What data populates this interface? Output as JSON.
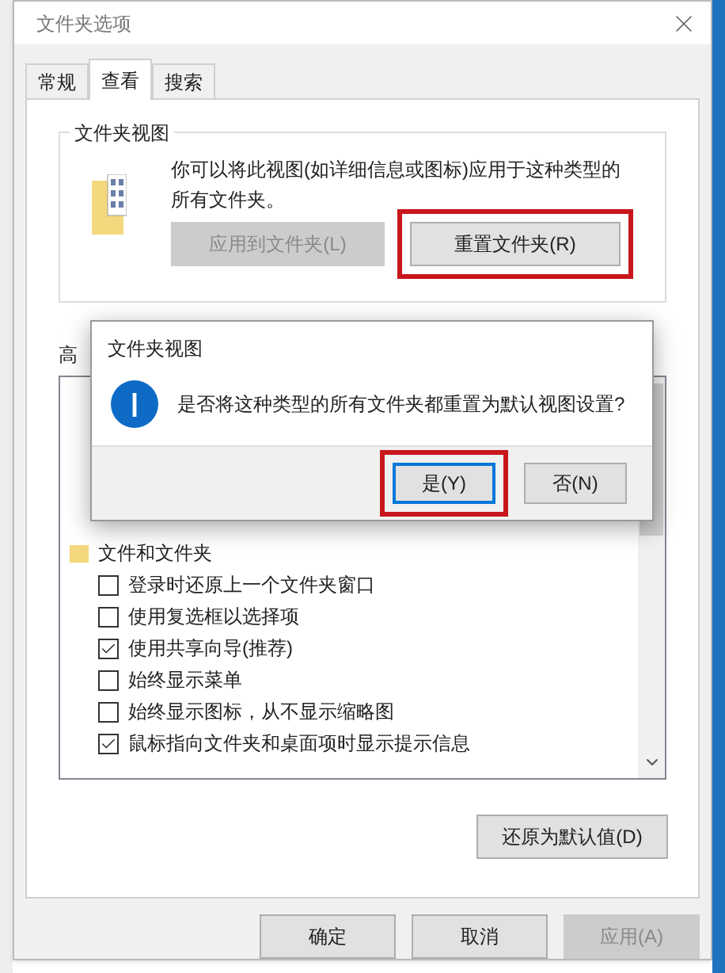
{
  "window": {
    "title": "文件夹选项"
  },
  "tabs": [
    {
      "label": "常规",
      "selected": false
    },
    {
      "label": "查看",
      "selected": true
    },
    {
      "label": "搜索",
      "selected": false
    }
  ],
  "folder_views": {
    "title": "文件夹视图",
    "description": "你可以将此视图(如详细信息或图标)应用于这种类型的所有文件夹。",
    "buttons": [
      {
        "label": "应用到文件夹(L)",
        "disabled": true,
        "highlighted": false
      },
      {
        "label": "重置文件夹(R)",
        "disabled": false,
        "highlighted": true
      }
    ]
  },
  "advanced": {
    "label": "高",
    "tree": [
      {
        "label": "文件和文件夹",
        "kind": "folder",
        "children": [
          {
            "label": "登录时还原上一个文件夹窗口",
            "kind": "checkbox",
            "checked": false
          },
          {
            "label": "使用复选框以选择项",
            "kind": "checkbox",
            "checked": false
          },
          {
            "label": "使用共享向导(推荐)",
            "kind": "checkbox",
            "checked": true
          },
          {
            "label": "始终显示菜单",
            "kind": "checkbox",
            "checked": false
          },
          {
            "label": "始终显示图标，从不显示缩略图",
            "kind": "checkbox",
            "checked": false
          },
          {
            "label": "鼠标指向文件夹和桌面项时显示提示信息",
            "kind": "checkbox",
            "checked": true
          }
        ]
      }
    ]
  },
  "restore_button": {
    "label": "还原为默认值(D)"
  },
  "footer_buttons": [
    {
      "label": "确定",
      "disabled": false
    },
    {
      "label": "取消",
      "disabled": false
    },
    {
      "label": "应用(A)",
      "disabled": true
    }
  ],
  "message_box": {
    "title": "文件夹视图",
    "message": "是否将这种类型的所有文件夹都重置为默认视图设置?",
    "buttons": [
      {
        "label": "是(Y)",
        "default": true,
        "highlighted": true
      },
      {
        "label": "否(N)",
        "default": false,
        "highlighted": false
      }
    ]
  }
}
